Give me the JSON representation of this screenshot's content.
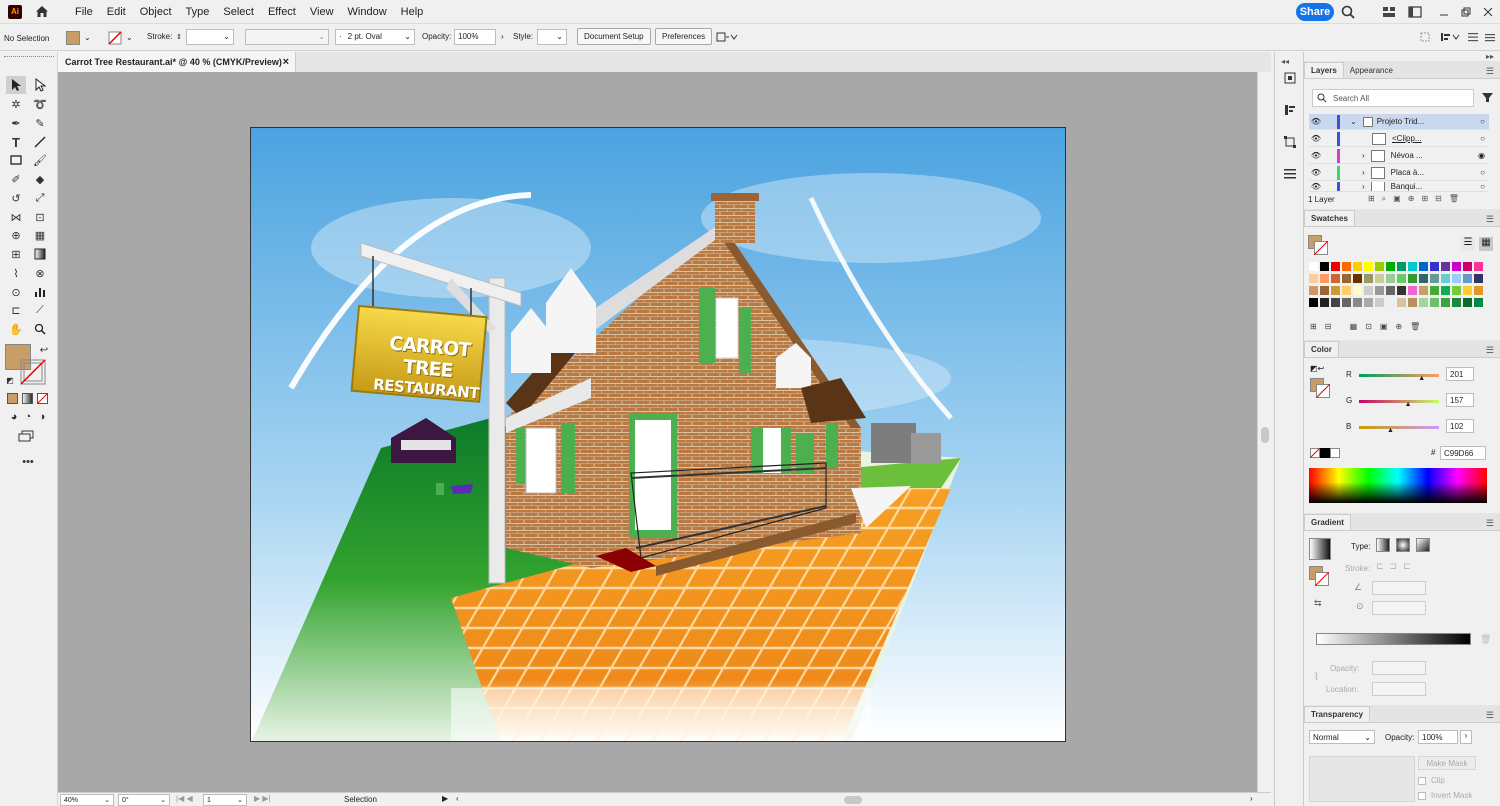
{
  "app": {
    "logo": "Ai"
  },
  "menu": [
    "File",
    "Edit",
    "Object",
    "Type",
    "Select",
    "Effect",
    "View",
    "Window",
    "Help"
  ],
  "share_label": "Share",
  "control": {
    "selection": "No Selection",
    "stroke_label": "Stroke:",
    "brush": "2 pt. Oval",
    "opacity_label": "Opacity:",
    "opacity_value": "100%",
    "style_label": "Style:",
    "document_setup": "Document Setup",
    "preferences": "Preferences"
  },
  "document": {
    "tab_title": "Carrot Tree Restaurant.ai* @ 40 % (CMYK/Preview)"
  },
  "artwork": {
    "sign_line1": "CARROT TREE",
    "sign_line2": "RESTAURANT"
  },
  "status": {
    "zoom": "40%",
    "rotation": "0°",
    "artboard_num": "1",
    "tool": "Selection"
  },
  "layers": {
    "tabs": [
      "Layers",
      "Appearance"
    ],
    "search_placeholder": "Search All",
    "rows": [
      "Projeto Trid...",
      "<Clipp...",
      "Névoa ...",
      "Placa à...",
      "Banqui..."
    ],
    "count": "1 Layer"
  },
  "swatches": {
    "title": "Swatches"
  },
  "color": {
    "title": "Color",
    "r_label": "R",
    "g_label": "G",
    "b_label": "B",
    "r": "201",
    "g": "157",
    "b": "102",
    "hex": "C99D66",
    "hash": "#",
    "r_level": 0.79,
    "g_level": 0.62,
    "b_level": 0.4
  },
  "gradient": {
    "title": "Gradient",
    "type_label": "Type:",
    "stroke_label": "Stroke:",
    "opacity_label": "Opacity:",
    "location_label": "Location:"
  },
  "transparency": {
    "title": "Transparency",
    "mode": "Normal",
    "opacity_label": "Opacity:",
    "opacity": "100%",
    "make_mask": "Make Mask",
    "clip": "Clip",
    "invert_mask": "Invert Mask"
  },
  "colors": {
    "fill": "#C99D66",
    "accent": "#1473e6"
  }
}
